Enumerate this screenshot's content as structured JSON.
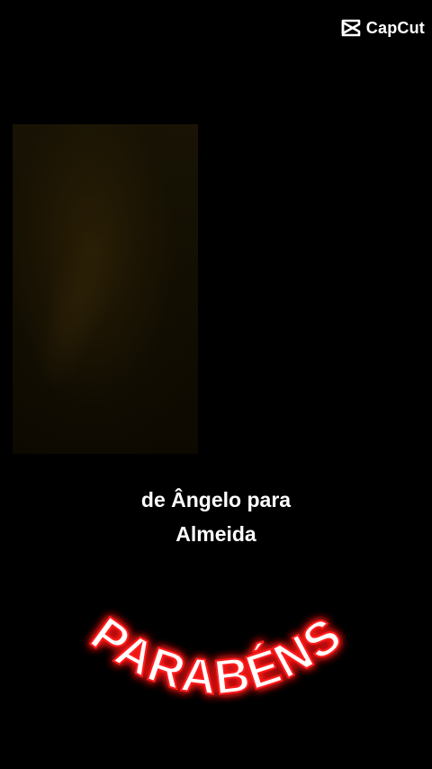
{
  "watermark": {
    "brand": "CapCut",
    "icon": "capcut-logo-icon"
  },
  "caption": {
    "line1": "de Ângelo para",
    "line2": "Almeida"
  },
  "title": {
    "text": "PARABÉNS"
  },
  "colors": {
    "background": "#000000",
    "title_glow": "#ff1a1a",
    "text": "#ffffff"
  }
}
